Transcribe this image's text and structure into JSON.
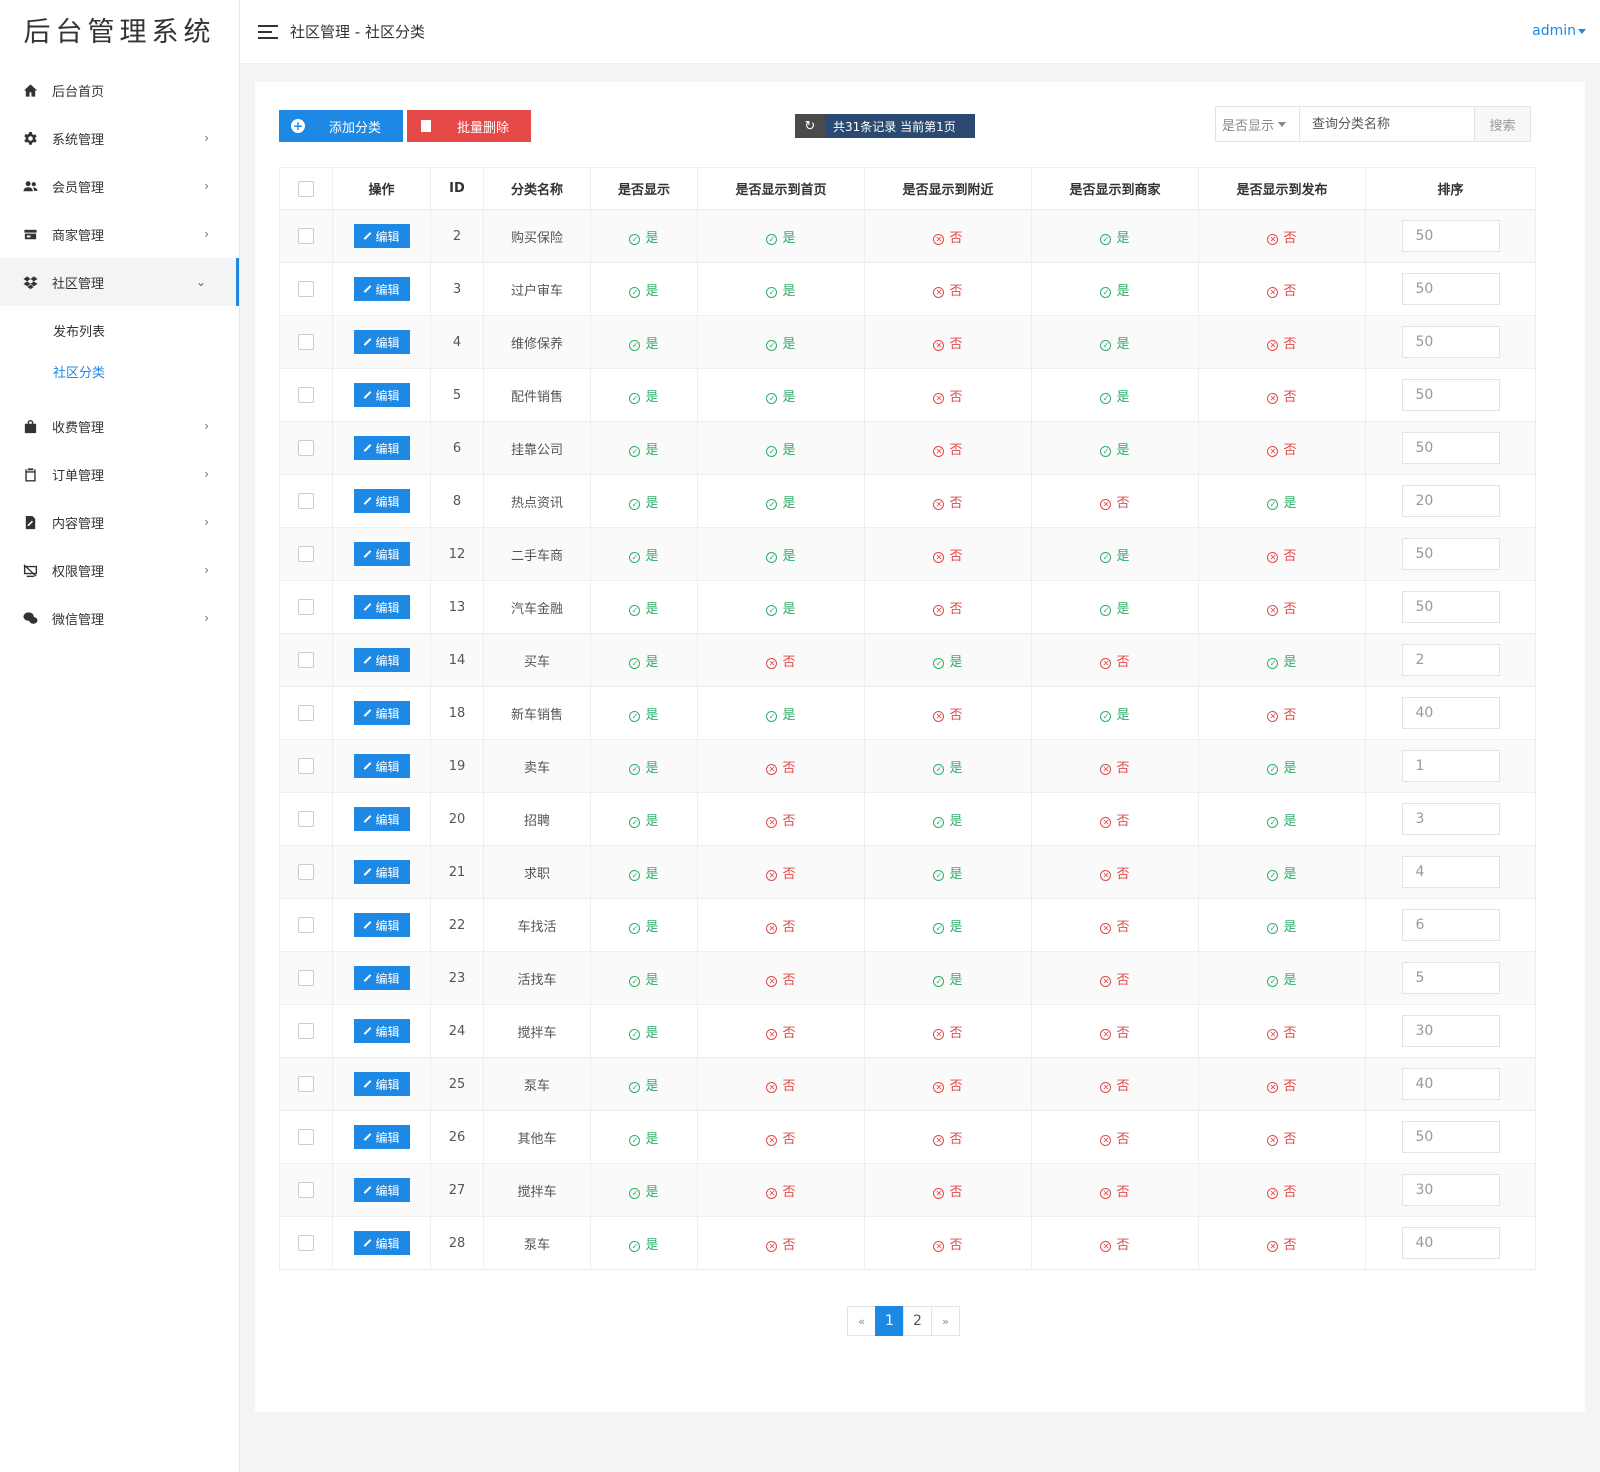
{
  "sidebar": {
    "logo": "后台管理系统",
    "items": [
      {
        "label": "后台首页",
        "icon": "home-icon",
        "arrow": ""
      },
      {
        "label": "系统管理",
        "icon": "gear-icon",
        "arrow": "›"
      },
      {
        "label": "会员管理",
        "icon": "users-icon",
        "arrow": "›"
      },
      {
        "label": "商家管理",
        "icon": "store-icon",
        "arrow": "›"
      },
      {
        "label": "社区管理",
        "icon": "dropbox-icon",
        "arrow": "⌄"
      },
      {
        "label": "收费管理",
        "icon": "shopping-bag-icon",
        "arrow": "›"
      },
      {
        "label": "订单管理",
        "icon": "clipboard-icon",
        "arrow": "›"
      },
      {
        "label": "内容管理",
        "icon": "file-edit-icon",
        "arrow": "›"
      },
      {
        "label": "权限管理",
        "icon": "monitor-off-icon",
        "arrow": "›"
      },
      {
        "label": "微信管理",
        "icon": "wechat-icon",
        "arrow": "›"
      }
    ],
    "sub_items": [
      {
        "label": "发布列表"
      },
      {
        "label": "社区分类"
      }
    ]
  },
  "header": {
    "breadcrumb": "社区管理 - 社区分类",
    "user": "admin"
  },
  "toolbar": {
    "add_label": "添加分类",
    "delete_label": "批量删除",
    "info": "共31条记录 当前第1页",
    "filter_label": "是否显示",
    "search_placeholder": "查询分类名称",
    "search_button": "搜索"
  },
  "table": {
    "columns": [
      "操作",
      "ID",
      "分类名称",
      "是否显示",
      "是否显示到首页",
      "是否显示到附近",
      "是否显示到商家",
      "是否显示到发布",
      "排序"
    ],
    "edit_label": "编辑",
    "yes_label": "是",
    "no_label": "否",
    "rows": [
      {
        "id": "2",
        "name": "购买保险",
        "show": true,
        "home": true,
        "nearby": false,
        "merchant": true,
        "publish": false,
        "sort": "50"
      },
      {
        "id": "3",
        "name": "过户审车",
        "show": true,
        "home": true,
        "nearby": false,
        "merchant": true,
        "publish": false,
        "sort": "50"
      },
      {
        "id": "4",
        "name": "维修保养",
        "show": true,
        "home": true,
        "nearby": false,
        "merchant": true,
        "publish": false,
        "sort": "50"
      },
      {
        "id": "5",
        "name": "配件销售",
        "show": true,
        "home": true,
        "nearby": false,
        "merchant": true,
        "publish": false,
        "sort": "50"
      },
      {
        "id": "6",
        "name": "挂靠公司",
        "show": true,
        "home": true,
        "nearby": false,
        "merchant": true,
        "publish": false,
        "sort": "50"
      },
      {
        "id": "8",
        "name": "热点资讯",
        "show": true,
        "home": true,
        "nearby": false,
        "merchant": false,
        "publish": true,
        "sort": "20"
      },
      {
        "id": "12",
        "name": "二手车商",
        "show": true,
        "home": true,
        "nearby": false,
        "merchant": true,
        "publish": false,
        "sort": "50"
      },
      {
        "id": "13",
        "name": "汽车金融",
        "show": true,
        "home": true,
        "nearby": false,
        "merchant": true,
        "publish": false,
        "sort": "50"
      },
      {
        "id": "14",
        "name": "买车",
        "show": true,
        "home": false,
        "nearby": true,
        "merchant": false,
        "publish": true,
        "sort": "2"
      },
      {
        "id": "18",
        "name": "新车销售",
        "show": true,
        "home": true,
        "nearby": false,
        "merchant": true,
        "publish": false,
        "sort": "40"
      },
      {
        "id": "19",
        "name": "卖车",
        "show": true,
        "home": false,
        "nearby": true,
        "merchant": false,
        "publish": true,
        "sort": "1"
      },
      {
        "id": "20",
        "name": "招聘",
        "show": true,
        "home": false,
        "nearby": true,
        "merchant": false,
        "publish": true,
        "sort": "3"
      },
      {
        "id": "21",
        "name": "求职",
        "show": true,
        "home": false,
        "nearby": true,
        "merchant": false,
        "publish": true,
        "sort": "4"
      },
      {
        "id": "22",
        "name": "车找活",
        "show": true,
        "home": false,
        "nearby": true,
        "merchant": false,
        "publish": true,
        "sort": "6"
      },
      {
        "id": "23",
        "name": "活找车",
        "show": true,
        "home": false,
        "nearby": true,
        "merchant": false,
        "publish": true,
        "sort": "5"
      },
      {
        "id": "24",
        "name": "搅拌车",
        "show": true,
        "home": false,
        "nearby": false,
        "merchant": false,
        "publish": false,
        "sort": "30"
      },
      {
        "id": "25",
        "name": "泵车",
        "show": true,
        "home": false,
        "nearby": false,
        "merchant": false,
        "publish": false,
        "sort": "40"
      },
      {
        "id": "26",
        "name": "其他车",
        "show": true,
        "home": false,
        "nearby": false,
        "merchant": false,
        "publish": false,
        "sort": "50"
      },
      {
        "id": "27",
        "name": "搅拌车",
        "show": true,
        "home": false,
        "nearby": false,
        "merchant": false,
        "publish": false,
        "sort": "30"
      },
      {
        "id": "28",
        "name": "泵车",
        "show": true,
        "home": false,
        "nearby": false,
        "merchant": false,
        "publish": false,
        "sort": "40"
      }
    ]
  },
  "pagination": {
    "prev": "«",
    "pages": [
      "1",
      "2"
    ],
    "current": "1",
    "next": "»"
  },
  "colors": {
    "primary": "#1e88e5",
    "danger": "#e64a48",
    "yes": "#2eae6a",
    "no": "#e04a4a",
    "info_badge": "#2a4a72"
  }
}
